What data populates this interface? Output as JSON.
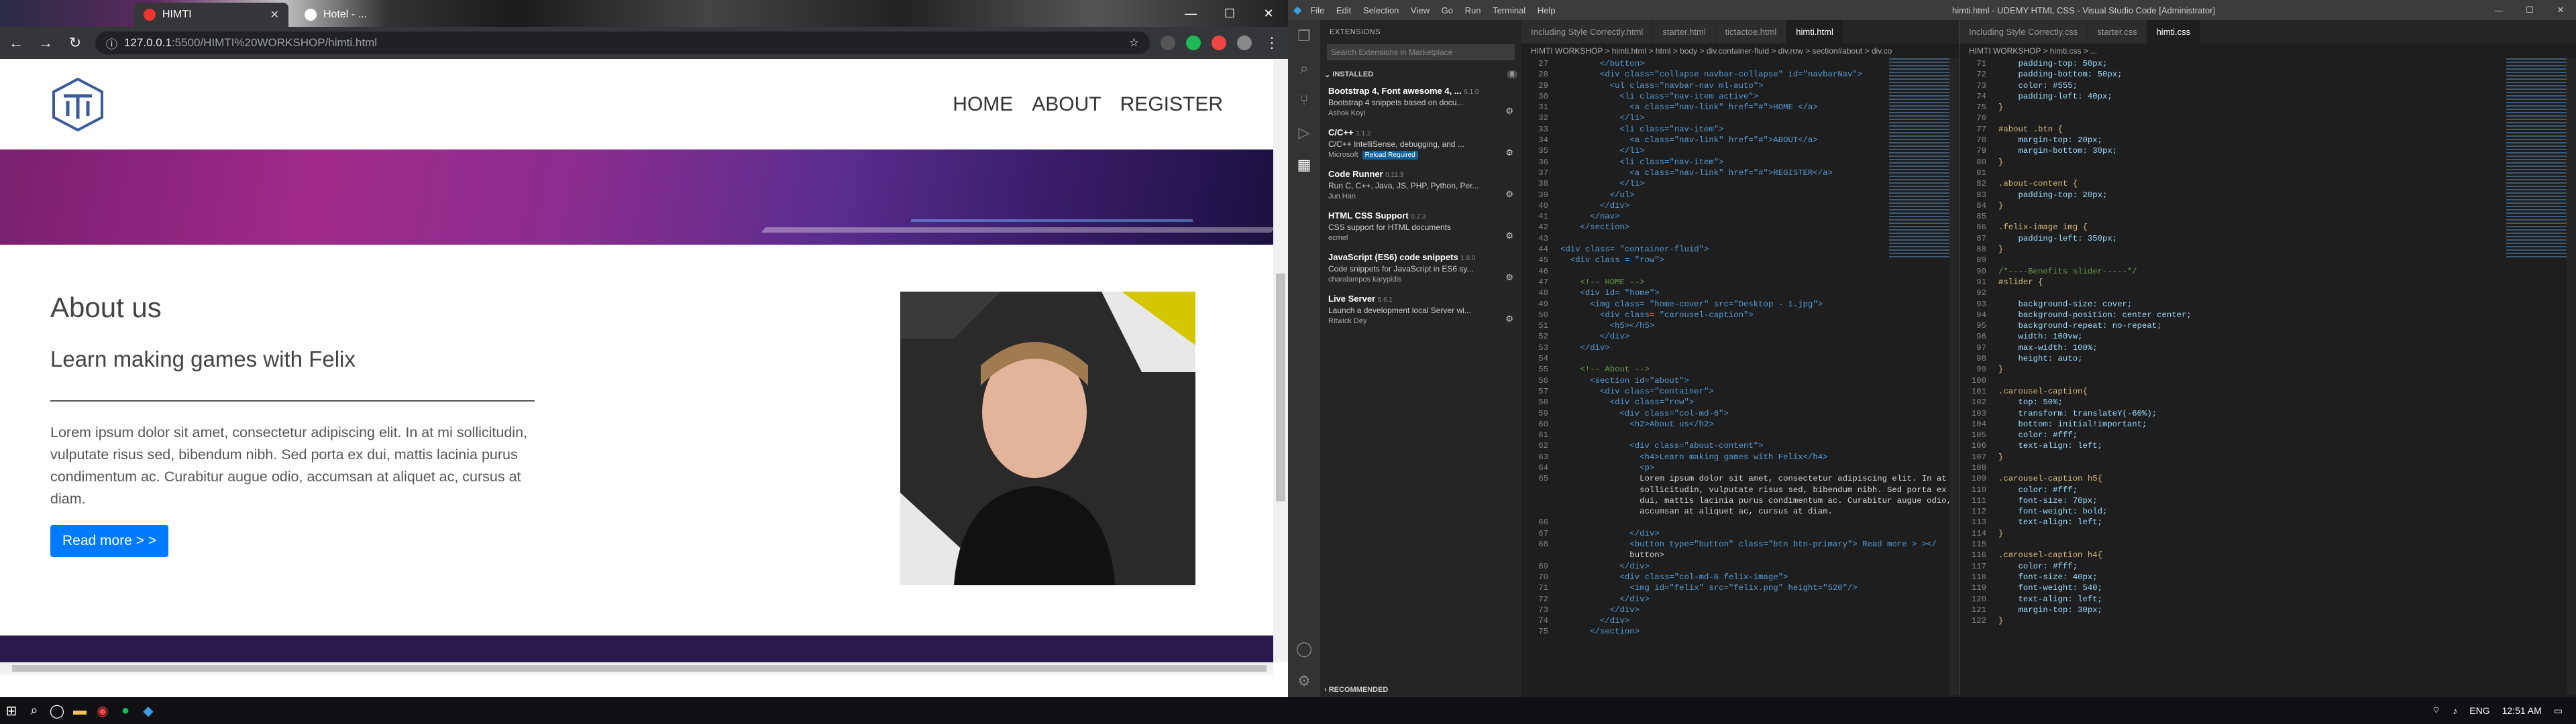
{
  "chrome": {
    "tabs": [
      {
        "title": "HIMTI"
      },
      {
        "title": "Hotel - ..."
      }
    ],
    "url_host": "127.0.0.1",
    "url_path": ":5500/HIMTI%20WORKSHOP/himti.html",
    "colors": {
      "chrome_bg": "#35363a"
    }
  },
  "site": {
    "nav": [
      "HOME",
      "ABOUT",
      "REGISTER"
    ],
    "about_title": "About us",
    "about_subtitle": "Learn making games with Felix",
    "about_text": "Lorem ipsum dolor sit amet, consectetur adipiscing elit. In at mi sollicitudin, vulputate risus sed, bibendum nibh. Sed porta ex dui, mattis lacinia purus condimentum ac. Curabitur augue odio, accumsan at aliquet ac, cursus at diam.",
    "read_more": "Read more > >",
    "accent": "#007bff"
  },
  "vscode": {
    "menu": [
      "File",
      "Edit",
      "Selection",
      "View",
      "Go",
      "Run",
      "Terminal",
      "Help"
    ],
    "title": "himti.html - UDEMY HTML CSS - Visual Studio Code [Administrator]",
    "sidebar_title": "EXTENSIONS",
    "search_placeholder": "Search Extensions in Marketplace",
    "installed_label": "INSTALLED",
    "installed_count": "8",
    "recommended_label": "RECOMMENDED",
    "extensions": [
      {
        "name": "Bootstrap 4, Font awesome 4, ...",
        "version": "6.1.0",
        "desc": "Bootstrap 4 snippets based on docu...",
        "author": "Ashok Koyi"
      },
      {
        "name": "C/C++",
        "version": "1.1.2",
        "desc": "C/C++ IntelliSense, debugging, and ...",
        "author": "Microsoft",
        "badge": "Reload Required"
      },
      {
        "name": "Code Runner",
        "version": "0.11.3",
        "desc": "Run C, C++, Java, JS, PHP, Python, Per...",
        "author": "Jun Han"
      },
      {
        "name": "HTML CSS Support",
        "version": "0.2.3",
        "desc": "CSS support for HTML documents",
        "author": "ecmel"
      },
      {
        "name": "JavaScript (ES6) code snippets",
        "version": "1.8.0",
        "desc": "Code snippets for JavaScript in ES6 sy...",
        "author": "charalampos karypidis"
      },
      {
        "name": "Live Server",
        "version": "5.6.1",
        "desc": "Launch a development local Server wi...",
        "author": "Ritwick Dey"
      }
    ],
    "group1_tabs": [
      "Including Style Correctly.html",
      "starter.html",
      "tictactoe.html",
      "himti.html"
    ],
    "group1_active": "himti.html",
    "group1_crumbs": "HIMTI WORKSHOP > himti.html > html > body > div.container-fluid > div.row > section#about > div.co",
    "group2_tabs": [
      "Including Style Correctly.css",
      "starter.css",
      "himti.css"
    ],
    "group2_active": "himti.css",
    "group2_crumbs": "HIMTI WORKSHOP > himti.css > ...",
    "html_lines": [
      [
        "27",
        "        </button>"
      ],
      [
        "28",
        "        <div class=\"collapse navbar-collapse\" id=\"navbarNav\">"
      ],
      [
        "29",
        "          <ul class=\"navbar-nav ml-auto\">"
      ],
      [
        "30",
        "            <li class=\"nav-item active\">"
      ],
      [
        "31",
        "              <a class=\"nav-link\" href=\"#\">HOME </a>"
      ],
      [
        "32",
        "            </li>"
      ],
      [
        "33",
        "            <li class=\"nav-item\">"
      ],
      [
        "34",
        "              <a class=\"nav-link\" href=\"#\">ABOUT</a>"
      ],
      [
        "35",
        "            </li>"
      ],
      [
        "36",
        "            <li class=\"nav-item\">"
      ],
      [
        "37",
        "              <a class=\"nav-link\" href=\"#\">REGISTER</a>"
      ],
      [
        "38",
        "            </li>"
      ],
      [
        "39",
        "          </ul>"
      ],
      [
        "40",
        "        </div>"
      ],
      [
        "41",
        "      </nav>"
      ],
      [
        "42",
        "    </section>"
      ],
      [
        "43",
        ""
      ],
      [
        "44",
        "<div class= \"container-fluid\">"
      ],
      [
        "45",
        "  <div class = \"row\">"
      ],
      [
        "46",
        ""
      ],
      [
        "47",
        "    <!-- HOME -->"
      ],
      [
        "48",
        "    <div id= \"home\">"
      ],
      [
        "49",
        "      <img class= \"home-cover\" src=\"Desktop - 1.jpg\">"
      ],
      [
        "50",
        "        <div class= \"carousel-caption\">"
      ],
      [
        "51",
        "          <h5></h5>"
      ],
      [
        "52",
        "        </div>"
      ],
      [
        "53",
        "    </div>"
      ],
      [
        "54",
        ""
      ],
      [
        "55",
        "    <!-- About -->"
      ],
      [
        "56",
        "      <section id=\"about\">"
      ],
      [
        "57",
        "        <div class=\"container\">"
      ],
      [
        "58",
        "          <div class=\"row\">"
      ],
      [
        "59",
        "            <div class=\"col-md-6\">"
      ],
      [
        "60",
        "              <h2>About us</h2>"
      ],
      [
        "61",
        ""
      ],
      [
        "62",
        "              <div class=\"about-content\">"
      ],
      [
        "63",
        "                <h4>Learn making games with Felix</h4>"
      ],
      [
        "64",
        "                <p>"
      ],
      [
        "65",
        "                Lorem ipsum dolor sit amet, consectetur adipiscing elit. In at mi"
      ],
      [
        "",
        "                sollicitudin, vulputate risus sed, bibendum nibh. Sed porta ex"
      ],
      [
        "",
        "                dui, mattis lacinia purus condimentum ac. Curabitur augue odio,"
      ],
      [
        "",
        "                accumsan at aliquet ac, cursus at diam."
      ],
      [
        "66",
        ""
      ],
      [
        "67",
        "              </div>"
      ],
      [
        "68",
        "              <button type=\"button\" class=\"btn btn-primary\"> Read more > ></"
      ],
      [
        "",
        "              button>"
      ],
      [
        "69",
        "            </div>"
      ],
      [
        "70",
        "            <div class=\"col-md-6 felix-image\">"
      ],
      [
        "71",
        "              <img id=\"felix\" src=\"felix.png\" height=\"520\"/>"
      ],
      [
        "72",
        "            </div>"
      ],
      [
        "73",
        "          </div>"
      ],
      [
        "74",
        "        </div>"
      ],
      [
        "75",
        "      </section>"
      ]
    ],
    "css_lines": [
      [
        "71",
        "    padding-top: 50px;"
      ],
      [
        "72",
        "    padding-bottom: 50px;"
      ],
      [
        "73",
        "    color: #555;"
      ],
      [
        "74",
        "    padding-left: 40px;"
      ],
      [
        "75",
        "}"
      ],
      [
        "76",
        ""
      ],
      [
        "77",
        "#about .btn {"
      ],
      [
        "78",
        "    margin-top: 20px;"
      ],
      [
        "79",
        "    margin-bottom: 30px;"
      ],
      [
        "80",
        "}"
      ],
      [
        "81",
        ""
      ],
      [
        "82",
        ".about-content {"
      ],
      [
        "83",
        "    padding-top: 20px;"
      ],
      [
        "84",
        "}"
      ],
      [
        "85",
        ""
      ],
      [
        "86",
        ".felix-image img {"
      ],
      [
        "87",
        "    padding-left: 350px;"
      ],
      [
        "88",
        "}"
      ],
      [
        "89",
        ""
      ],
      [
        "90",
        "/*----Benefits slider-----*/"
      ],
      [
        "91",
        "#slider {"
      ],
      [
        "92",
        ""
      ],
      [
        "93",
        "    background-size: cover;"
      ],
      [
        "94",
        "    background-position: center center;"
      ],
      [
        "95",
        "    background-repeat: no-repeat;"
      ],
      [
        "96",
        "    width: 100vw;"
      ],
      [
        "97",
        "    max-width: 100%;"
      ],
      [
        "98",
        "    height: auto;"
      ],
      [
        "99",
        "}"
      ],
      [
        "100",
        ""
      ],
      [
        "101",
        ".carousel-caption{"
      ],
      [
        "102",
        "    top: 50%;"
      ],
      [
        "103",
        "    transform: translateY(-60%);"
      ],
      [
        "104",
        "    bottom: initial!important;"
      ],
      [
        "105",
        "    color: #fff;"
      ],
      [
        "106",
        "    text-align: left;"
      ],
      [
        "107",
        "}"
      ],
      [
        "108",
        ""
      ],
      [
        "109",
        ".carousel-caption h5{"
      ],
      [
        "110",
        "    color: #fff;"
      ],
      [
        "111",
        "    font-size: 70px;"
      ],
      [
        "112",
        "    font-weight: bold;"
      ],
      [
        "113",
        "    text-align: left;"
      ],
      [
        "114",
        "}"
      ],
      [
        "115",
        ""
      ],
      [
        "116",
        ".carousel-caption h4{"
      ],
      [
        "117",
        "    color: #fff;"
      ],
      [
        "118",
        "    font-size: 40px;"
      ],
      [
        "119",
        "    font-weight: 540;"
      ],
      [
        "120",
        "    text-align: left;"
      ],
      [
        "121",
        "    margin-top: 30px;"
      ],
      [
        "122",
        "}"
      ]
    ],
    "taskbar_lang": "ENG",
    "taskbar_time": "12:51 AM"
  }
}
